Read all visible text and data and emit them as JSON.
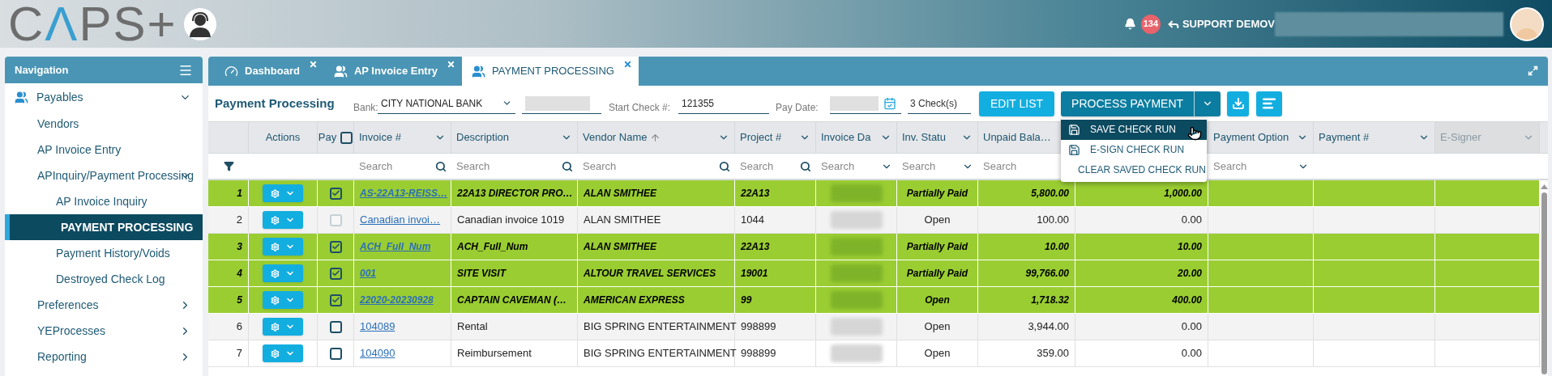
{
  "header": {
    "logo": "CΛPS+",
    "notifications": "134",
    "user": "SUPPORT DEMOV"
  },
  "sidebar": {
    "title": "Navigation",
    "items": [
      {
        "label": "Payables",
        "kind": "section",
        "expanded": true,
        "selected": false,
        "children": [
          {
            "label": "Vendors",
            "kind": "link",
            "selected": false
          },
          {
            "label": "AP Invoice Entry",
            "kind": "link",
            "selected": false
          },
          {
            "label": "APInquiry/Payment Processing",
            "kind": "group",
            "expanded": true,
            "selected": false,
            "children": [
              {
                "label": "AP Invoice Inquiry",
                "kind": "link",
                "selected": false
              },
              {
                "label": "PAYMENT PROCESSING",
                "kind": "link",
                "selected": true
              },
              {
                "label": "Payment History/Voids",
                "kind": "link",
                "selected": false
              },
              {
                "label": "Destroyed Check Log",
                "kind": "link",
                "selected": false
              }
            ]
          }
        ]
      },
      {
        "label": "Preferences",
        "kind": "group",
        "expanded": false,
        "selected": false
      },
      {
        "label": "YEProcesses",
        "kind": "group",
        "expanded": false,
        "selected": false
      },
      {
        "label": "Reporting",
        "kind": "group",
        "expanded": false,
        "selected": false
      }
    ]
  },
  "tabs": [
    {
      "label": "Dashboard",
      "kind": "gauge",
      "selected": false
    },
    {
      "label": "AP Invoice Entry",
      "kind": "people",
      "selected": false
    },
    {
      "label": "PAYMENT PROCESSING",
      "kind": "people",
      "selected": true
    }
  ],
  "toolbar": {
    "title": "Payment Processing",
    "bank_label": "Bank:",
    "bank": "CITY NATIONAL BANK",
    "start_check_label": "Start Check #:",
    "start_check": "121355",
    "pay_date_label": "Pay Date:",
    "checks": "3 Check(s)",
    "edit_button": "EDIT LIST",
    "process_button": "PROCESS PAYMENT"
  },
  "process_menu": [
    {
      "label": "SAVE CHECK RUN",
      "kind": "save",
      "selected": true
    },
    {
      "label": "E-SIGN CHECK RUN",
      "kind": "save",
      "selected": false
    },
    {
      "label": "CLEAR SAVED CHECK RUN",
      "kind": "clear",
      "selected": false
    }
  ],
  "table": {
    "columns": [
      {
        "label": "Actions",
        "menu": false,
        "sorted": false,
        "disabled": false
      },
      {
        "label": "Pay",
        "menu": false,
        "sorted": false,
        "disabled": false,
        "select_all": false
      },
      {
        "label": "Invoice #",
        "menu": true,
        "sorted": false,
        "disabled": false,
        "filter": {
          "kind": "search",
          "placeholder": "Search"
        }
      },
      {
        "label": "Description",
        "menu": true,
        "sorted": false,
        "disabled": false,
        "filter": {
          "kind": "search",
          "placeholder": "Search"
        }
      },
      {
        "label": "Vendor Name",
        "menu": true,
        "sorted": true,
        "disabled": false,
        "filter": {
          "kind": "search",
          "placeholder": "Search"
        }
      },
      {
        "label": "Project #",
        "menu": true,
        "sorted": false,
        "disabled": false,
        "filter": {
          "kind": "search",
          "placeholder": "Search"
        }
      },
      {
        "label": "Invoice Da",
        "menu": true,
        "sorted": false,
        "disabled": false,
        "filter": {
          "kind": "dropdown",
          "placeholder": "Search"
        }
      },
      {
        "label": "Inv. Statu",
        "menu": true,
        "sorted": false,
        "disabled": false,
        "filter": {
          "kind": "dropdown",
          "placeholder": "Search"
        }
      },
      {
        "label": "Unpaid Bala…",
        "sorted": false,
        "disabled": false,
        "filter": {
          "kind": "plain",
          "placeholder": "Search"
        }
      },
      {
        "label": "Payment Option",
        "menu": true,
        "sorted": false,
        "disabled": false,
        "filter": {
          "kind": "dropdown",
          "placeholder": "Search"
        }
      },
      {
        "label": "Payment #",
        "menu": true,
        "sorted": false,
        "disabled": false
      },
      {
        "label": "E-Signer",
        "menu": true,
        "sorted": false,
        "disabled": true
      }
    ],
    "rows": [
      {
        "number": "1",
        "selected": true,
        "checked": true,
        "disabled": false,
        "invoice": "AS-22A13-REISS…",
        "description": "22A13 DIRECTOR PRO…",
        "vendor": "ALAN SMITHEE",
        "project": "22A13",
        "status": "Partially Paid",
        "unpaid": "5,800.00",
        "column_11": "1,000.00"
      },
      {
        "number": "2",
        "selected": false,
        "checked": false,
        "disabled": true,
        "invoice": "Canadian invoi…",
        "description": "Canadian invoice 1019",
        "vendor": "ALAN SMITHEE",
        "project": "1044",
        "status": "Open",
        "unpaid": "100.00",
        "column_11": "0.00"
      },
      {
        "number": "3",
        "selected": true,
        "checked": true,
        "disabled": false,
        "invoice": "ACH_Full_Num",
        "description": "ACH_Full_Num",
        "vendor": "ALAN SMITHEE",
        "project": "22A13",
        "status": "Partially Paid",
        "unpaid": "10.00",
        "column_11": "10.00"
      },
      {
        "number": "4",
        "selected": true,
        "checked": true,
        "disabled": false,
        "invoice": "001",
        "description": "SITE VISIT",
        "vendor": "ALTOUR TRAVEL SERVICES",
        "project": "19001",
        "status": "Partially Paid",
        "unpaid": "99,766.00",
        "column_11": "20.00"
      },
      {
        "number": "5",
        "selected": true,
        "checked": true,
        "disabled": false,
        "invoice": "22020-20230928",
        "description": "CAPTAIN CAVEMAN (…",
        "vendor": "AMERICAN EXPRESS",
        "project": "99",
        "status": "Open",
        "unpaid": "1,718.32",
        "column_11": "400.00"
      },
      {
        "number": "6",
        "selected": false,
        "checked": false,
        "disabled": false,
        "invoice": "104089",
        "description": "Rental",
        "vendor": "BIG SPRING ENTERTAINMENT",
        "project": "998899",
        "status": "Open",
        "unpaid": "3,944.00",
        "column_11": "0.00"
      },
      {
        "number": "7",
        "selected": false,
        "checked": false,
        "disabled": false,
        "invoice": "104090",
        "description": "Reimbursement",
        "vendor": "BIG SPRING ENTERTAINMENT",
        "project": "998899",
        "status": "Open",
        "unpaid": "359.00",
        "column_11": "0.00"
      }
    ]
  }
}
